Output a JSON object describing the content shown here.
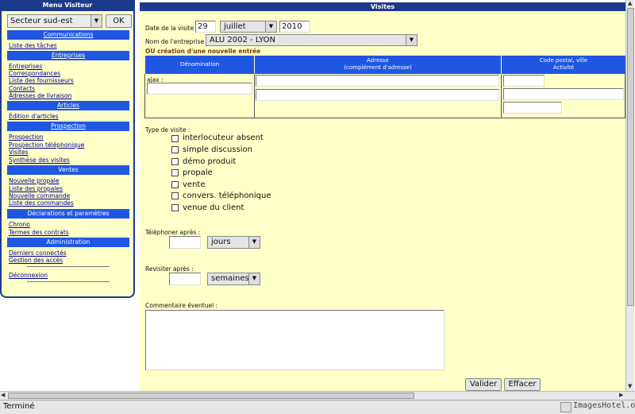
{
  "sidebar": {
    "title": "Menu Visiteur",
    "sector_value": "Secteur sud-est",
    "ok_label": "OK",
    "sections": {
      "communications": "Communications",
      "entreprises": "Entreprises",
      "articles": "Articles",
      "prospection": "Prospection",
      "ventes": "Ventes",
      "declarations": "Déclarations et paramètres",
      "administration": "Administration"
    },
    "links": {
      "liste_taches": "Liste des tâches",
      "entreprises": "Entreprises",
      "correspondances": "Correspondances",
      "fournisseurs": "Liste des fournisseurs",
      "contacts": "Contacts",
      "adresses_livraison": "Adresses de livraison",
      "edition_articles": "Édition d'articles",
      "prospection": "Prospection",
      "prospection_tel": "Prospection téléphonique",
      "visites": "Visites",
      "synthese_visites": "Synthèse des visites",
      "nouvelle_propale": "Nouvelle propale",
      "liste_propales": "Liste des propales",
      "nouvelle_commande": "Nouvelle commande",
      "liste_commandes": "Liste des commandes",
      "chrono": "Chrono",
      "termes_contrats": "Termes des contrats",
      "derniers_connectes": "Derniers connectés",
      "gestion_acces": "Gestion des accès",
      "deconnexion": "Déconnexion"
    }
  },
  "main": {
    "title": "Visites",
    "date_label": "Date de la visite :",
    "date_day": "29",
    "date_month": "juillet",
    "date_year": "2010",
    "entreprise_label": "Nom de l'entreprise :",
    "entreprise_value": "ALU 2002 - LYON",
    "new_entry_label": "OU création d'une nouvelle entrée",
    "table": {
      "col_denomination": "Dénomination",
      "col_adresse": "Adresse",
      "col_adresse_sub": "(complément d'adresse)",
      "col_cp": "Code postal, ville",
      "col_cp_sub": "Activité",
      "ajax_label": "ajax :"
    },
    "type_label": "Type de visite :",
    "visit_types": [
      "interlocuteur absent",
      "simple discussion",
      "démo produit",
      "propale",
      "vente",
      "convers. téléphonique",
      "venue du client"
    ],
    "telephoner_label": "Téléphoner après :",
    "telephoner_unit": "jours",
    "revisiter_label": "Revisiter après :",
    "revisiter_unit": "semaines",
    "comment_label": "Commentaire éventuel :",
    "validate_label": "Valider",
    "clear_label": "Effacer"
  },
  "statusbar": {
    "text": "Terminé",
    "watermark": "ImagesHotel.org"
  }
}
